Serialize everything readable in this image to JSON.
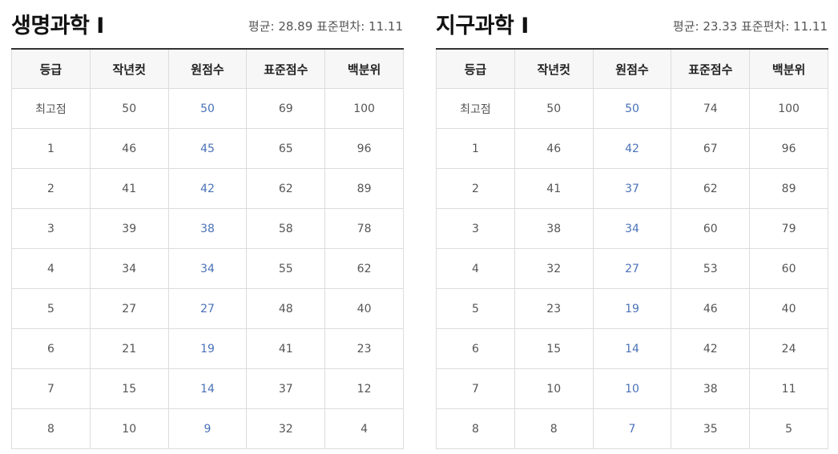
{
  "headers": [
    "등급",
    "작년컷",
    "원점수",
    "표준점수",
    "백분위"
  ],
  "tables": [
    {
      "title": "생명과학 Ⅰ",
      "stats": "평균: 28.89 표준편차: 11.11",
      "rows": [
        [
          "최고점",
          "50",
          "50",
          "69",
          "100"
        ],
        [
          "1",
          "46",
          "45",
          "65",
          "96"
        ],
        [
          "2",
          "41",
          "42",
          "62",
          "89"
        ],
        [
          "3",
          "39",
          "38",
          "58",
          "78"
        ],
        [
          "4",
          "34",
          "34",
          "55",
          "62"
        ],
        [
          "5",
          "27",
          "27",
          "48",
          "40"
        ],
        [
          "6",
          "21",
          "19",
          "41",
          "23"
        ],
        [
          "7",
          "15",
          "14",
          "37",
          "12"
        ],
        [
          "8",
          "10",
          "9",
          "32",
          "4"
        ]
      ]
    },
    {
      "title": "지구과학 Ⅰ",
      "stats": "평균: 23.33 표준편차: 11.11",
      "rows": [
        [
          "최고점",
          "50",
          "50",
          "74",
          "100"
        ],
        [
          "1",
          "46",
          "42",
          "67",
          "96"
        ],
        [
          "2",
          "41",
          "37",
          "62",
          "89"
        ],
        [
          "3",
          "38",
          "34",
          "60",
          "79"
        ],
        [
          "4",
          "32",
          "27",
          "53",
          "60"
        ],
        [
          "5",
          "23",
          "19",
          "46",
          "40"
        ],
        [
          "6",
          "15",
          "14",
          "42",
          "24"
        ],
        [
          "7",
          "10",
          "10",
          "38",
          "11"
        ],
        [
          "8",
          "8",
          "7",
          "35",
          "5"
        ]
      ]
    }
  ],
  "colors": {
    "raw_score": "#4a72b8",
    "header_bg": "#f7f7f7",
    "border": "#dcdcdc"
  }
}
